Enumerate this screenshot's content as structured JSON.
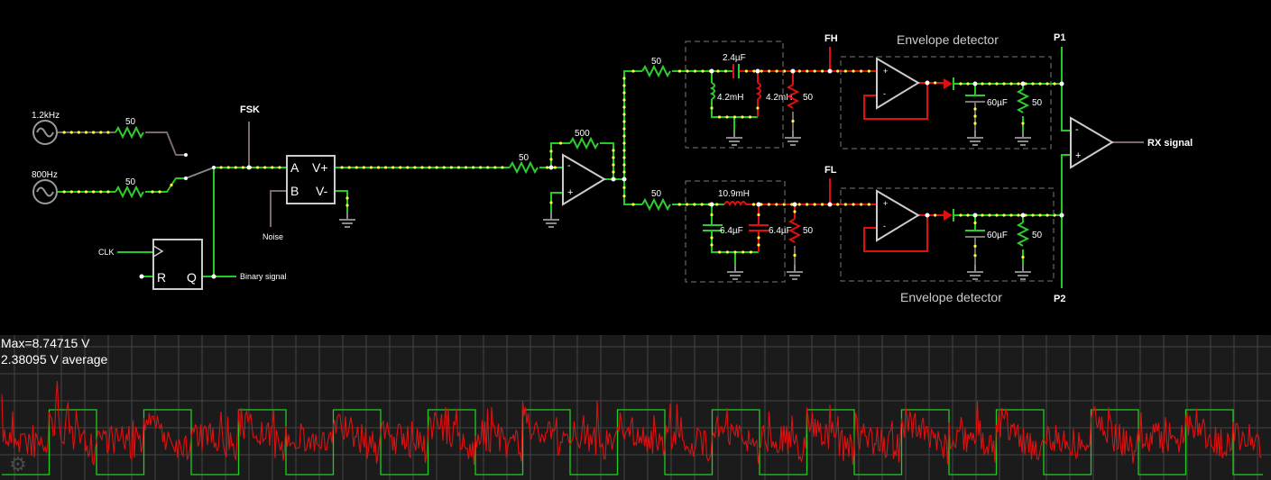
{
  "labels": {
    "src_high": "1.2kHz",
    "src_low": "800Hz",
    "r1": "50",
    "r2": "50",
    "fsk": "FSK",
    "clk": "CLK",
    "ff_r": "R",
    "ff_q": "Q",
    "binary": "Binary signal",
    "noise_a": "A",
    "noise_b": "B",
    "noise_vp": "V+",
    "noise_vm": "V-",
    "noise": "Noise",
    "r_in": "50",
    "r_fb": "500",
    "r_top": "50",
    "r_bot": "50",
    "c_top": "2.4µF",
    "l_top1": "4.2mH",
    "l_top2": "4.2mH",
    "r_top_load": "50",
    "l_bot": "10.9mH",
    "c_bot1": "6.4µF",
    "c_bot2": "6.4µF",
    "r_bot_load": "50",
    "fh": "FH",
    "fl": "FL",
    "env_top": "Envelope detector",
    "env_bot": "Envelope detector",
    "c_env_top": "60µF",
    "r_env_top": "50",
    "c_env_bot": "60µF",
    "r_env_bot": "50",
    "p1": "P1",
    "p2": "P2",
    "rx": "RX signal",
    "minus": "-",
    "plus": "+"
  },
  "scope": {
    "max_text": "Max=8.74715 V",
    "avg_text": "2.38095 V average",
    "settings_icon": "gear-icon",
    "series": [
      {
        "color": "#22cc22",
        "kind": "binary square wave"
      },
      {
        "color": "#e01010",
        "kind": "rx noisy signal"
      }
    ]
  },
  "colors": {
    "wire_active": "#22cc22",
    "wire_red": "#e01010",
    "wire_idle": "#7a6a68",
    "current_dot": "#ffff40",
    "component": "#cccccc",
    "scope_bg": "#1b1b1b",
    "scope_grid": "#555555"
  }
}
